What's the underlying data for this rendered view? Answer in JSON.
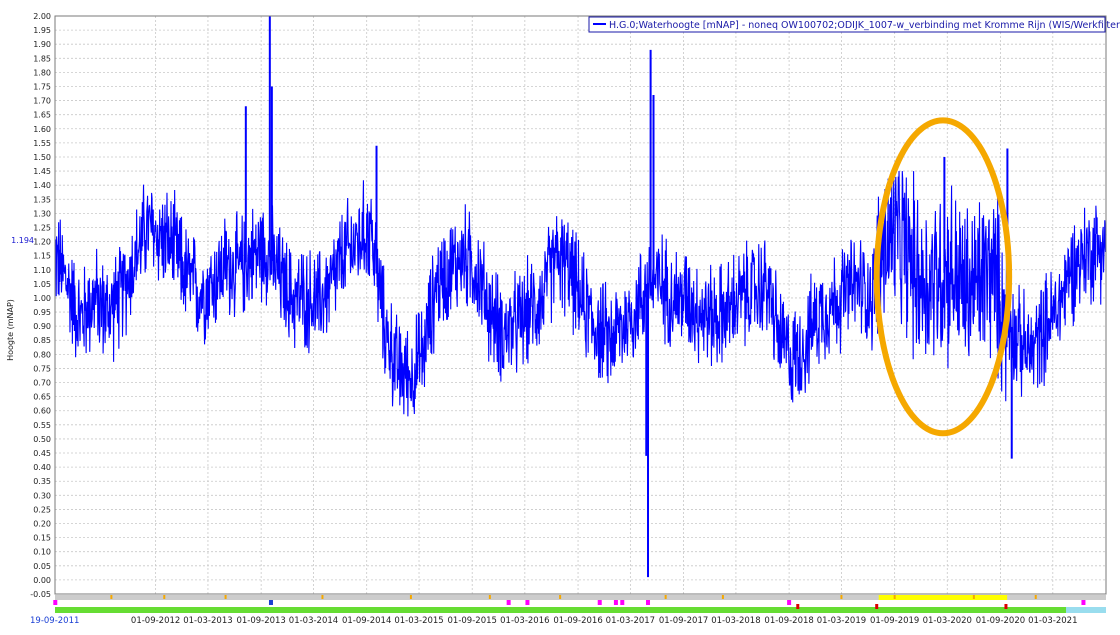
{
  "chart_data": {
    "type": "line",
    "legend_label": "H.G.0;Waterhoogte [mNAP] - noneq OW100702;ODIJK_1007-w_verbinding met Kromme Rijn (WIS/Werkfilter)",
    "legend_position": "top-right",
    "ylabel": "Hoogte (mNAP)",
    "ylim": [
      -0.05,
      2.0
    ],
    "y_tick_step": 0.05,
    "current_value_label": "1.194",
    "current_value": 1.194,
    "start_label": "19-09-2011",
    "x_range": [
      "2011-09-19",
      "2021-09-01"
    ],
    "x_ticks": [
      "01-09-2012",
      "01-03-2013",
      "01-09-2013",
      "01-03-2014",
      "01-09-2014",
      "01-03-2015",
      "01-09-2015",
      "01-03-2016",
      "01-09-2016",
      "01-03-2017",
      "01-09-2017",
      "01-03-2018",
      "01-09-2018",
      "01-03-2019",
      "01-09-2019",
      "01-03-2020",
      "01-09-2020",
      "01-03-2021"
    ],
    "grid": true,
    "line_color": "#0000ff",
    "highlight_color": "#f5a800",
    "series": [
      {
        "points": [
          [
            "2011-09-19",
            1.15
          ],
          [
            "2011-11-01",
            1.05
          ],
          [
            "2011-12-15",
            0.92
          ],
          [
            "2012-02-01",
            1.0
          ],
          [
            "2012-03-15",
            0.95
          ],
          [
            "2012-05-01",
            1.0
          ],
          [
            "2012-06-15",
            1.12
          ],
          [
            "2012-08-01",
            1.25
          ],
          [
            "2012-09-15",
            1.22
          ],
          [
            "2012-11-01",
            1.18
          ],
          [
            "2012-12-15",
            1.08
          ],
          [
            "2013-02-01",
            1.02
          ],
          [
            "2013-03-15",
            1.05
          ],
          [
            "2013-05-01",
            1.12
          ],
          [
            "2013-06-15",
            1.1
          ],
          [
            "2013-08-01",
            1.15
          ],
          [
            "2013-09-15",
            1.18
          ],
          [
            "2013-11-01",
            1.08
          ],
          [
            "2013-12-15",
            1.0
          ],
          [
            "2014-02-01",
            1.0
          ],
          [
            "2014-03-15",
            0.98
          ],
          [
            "2014-05-01",
            1.05
          ],
          [
            "2014-06-15",
            1.15
          ],
          [
            "2014-08-01",
            1.2
          ],
          [
            "2014-09-15",
            1.25
          ],
          [
            "2014-11-01",
            0.9
          ],
          [
            "2014-12-15",
            0.75
          ],
          [
            "2015-02-01",
            0.72
          ],
          [
            "2015-03-15",
            0.8
          ],
          [
            "2015-05-01",
            1.05
          ],
          [
            "2015-06-15",
            1.1
          ],
          [
            "2015-08-01",
            1.15
          ],
          [
            "2015-09-15",
            1.1
          ],
          [
            "2015-11-01",
            0.95
          ],
          [
            "2015-12-15",
            0.88
          ],
          [
            "2016-02-01",
            0.9
          ],
          [
            "2016-03-15",
            0.95
          ],
          [
            "2016-05-01",
            1.0
          ],
          [
            "2016-06-15",
            1.15
          ],
          [
            "2016-08-01",
            1.1
          ],
          [
            "2016-09-15",
            0.98
          ],
          [
            "2016-11-01",
            0.9
          ],
          [
            "2016-12-15",
            0.85
          ],
          [
            "2017-02-01",
            0.9
          ],
          [
            "2017-03-15",
            0.95
          ],
          [
            "2017-05-01",
            1.05
          ],
          [
            "2017-06-15",
            1.05
          ],
          [
            "2017-08-01",
            1.0
          ],
          [
            "2017-09-15",
            1.0
          ],
          [
            "2017-11-01",
            0.95
          ],
          [
            "2017-12-15",
            0.93
          ],
          [
            "2018-02-01",
            0.95
          ],
          [
            "2018-03-15",
            1.0
          ],
          [
            "2018-05-01",
            1.02
          ],
          [
            "2018-06-15",
            1.05
          ],
          [
            "2018-08-01",
            0.85
          ],
          [
            "2018-09-15",
            0.78
          ],
          [
            "2018-11-01",
            0.85
          ],
          [
            "2018-12-15",
            0.95
          ],
          [
            "2019-02-01",
            0.98
          ],
          [
            "2019-03-15",
            1.02
          ],
          [
            "2019-05-01",
            1.05
          ],
          [
            "2019-06-15",
            1.0
          ],
          [
            "2019-08-01",
            1.2
          ],
          [
            "2019-09-15",
            1.22
          ],
          [
            "2019-11-01",
            1.12
          ],
          [
            "2019-12-15",
            1.05
          ],
          [
            "2020-02-01",
            1.08
          ],
          [
            "2020-03-15",
            1.1
          ],
          [
            "2020-05-01",
            1.02
          ],
          [
            "2020-06-15",
            1.05
          ],
          [
            "2020-08-01",
            1.1
          ],
          [
            "2020-09-15",
            0.95
          ],
          [
            "2020-11-01",
            0.85
          ],
          [
            "2020-12-15",
            0.8
          ],
          [
            "2021-02-01",
            0.9
          ],
          [
            "2021-03-15",
            0.95
          ],
          [
            "2021-05-01",
            1.1
          ],
          [
            "2021-06-15",
            1.15
          ],
          [
            "2021-08-01",
            1.18
          ],
          [
            "2021-09-01",
            1.2
          ]
        ],
        "spikes": [
          [
            "2013-07-10",
            1.68
          ],
          [
            "2013-10-01",
            2.0
          ],
          [
            "2013-10-08",
            1.75
          ],
          [
            "2014-10-05",
            1.54
          ],
          [
            "2017-05-01",
            0.01
          ],
          [
            "2017-05-10",
            1.88
          ],
          [
            "2017-05-20",
            1.72
          ],
          [
            "2017-04-25",
            0.44
          ],
          [
            "2020-02-20",
            1.5
          ],
          [
            "2020-09-25",
            1.53
          ],
          [
            "2020-10-10",
            0.43
          ]
        ]
      }
    ],
    "highlight_region": {
      "shape": "ellipse",
      "from": "2019-07-01",
      "to": "2020-10-01",
      "y_from": 0.52,
      "y_to": 1.63
    }
  }
}
